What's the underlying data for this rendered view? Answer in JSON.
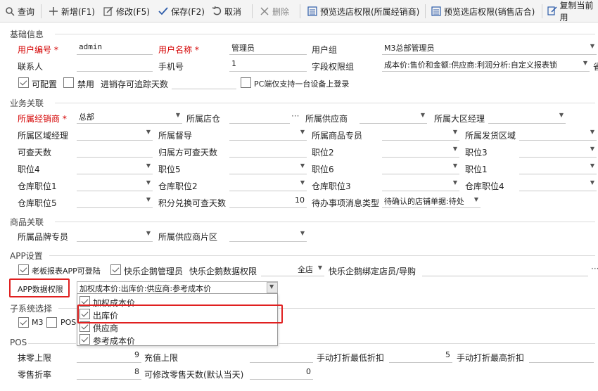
{
  "toolbar": {
    "query": "查询",
    "new": "新增(F1)",
    "edit": "修改(F5)",
    "save": "保存(F2)",
    "cancel": "取消",
    "delete": "删除",
    "preview_dealer": "预览选店权限(所属经销商)",
    "preview_sales": "预览选店权限(销售店合)",
    "copy": "复制当前用"
  },
  "sections": {
    "basic": "基础信息",
    "business": "业务关联",
    "goods": "商品关联",
    "app": "APP设置",
    "subsystem": "子系统选择",
    "pos": "POS"
  },
  "basic": {
    "user_no_label": "用户编号",
    "user_no": "admin",
    "user_name_label": "用户名称",
    "user_name": "管理员",
    "group_label": "用户组",
    "group": "M3总部管理员",
    "contact_label": "联系人",
    "contact": "",
    "phone_label": "手机号",
    "phone": "1",
    "field_perm_label": "字段权限组",
    "field_perm": "成本价:售价和金额:供应商:利润分析:自定义报表锁",
    "field_perm_more": "省",
    "configurable_label": "可配置",
    "disabled_label": "禁用",
    "stock_days_label": "进销存可追踪天数",
    "stock_days": "",
    "pc_single_label": "PC端仅支持一台设备上登录"
  },
  "business": {
    "dealer_label": "所属经销商",
    "dealer": "总部",
    "store_label": "所属店仓",
    "store": "",
    "supplier_label": "所属供应商",
    "region_mgr_label": "所属大区经理",
    "area_mgr_label": "所属区域经理",
    "supervisor_label": "所属督导",
    "goods_specialist_label": "所属商品专员",
    "ship_area_label": "所属发货区域",
    "query_days_label": "可查天数",
    "return_days_label": "归属方可查天数",
    "pos2_label": "职位2",
    "pos3_label": "职位3",
    "pos4_label": "职位4",
    "pos5_label": "职位5",
    "pos6_label": "职位6",
    "pos1_label": "职位1",
    "wh_pos1_label": "仓库职位1",
    "wh_pos2_label": "仓库职位2",
    "wh_pos3_label": "仓库职位3",
    "wh_pos4_label": "仓库职位4",
    "wh_pos5_label": "仓库职位5",
    "points_days_label": "积分兑换可查天数",
    "points_days": "10",
    "todo_type_label": "待办事项消息类型",
    "todo_type": "待确认的店铺单据:待处"
  },
  "goods": {
    "brand_specialist_label": "所属品牌专员",
    "supplier_area_label": "所属供应商片区"
  },
  "app": {
    "boss_report_label": "老板报表APP可登陆",
    "wecom_admin_label": "快乐企鹅管理员",
    "wecom_data_perm_label": "快乐企鹅数据权限",
    "wecom_data_perm": "全店",
    "wecom_bind_label": "快乐企鹅绑定店员/导购",
    "app_data_perm_label": "APP数据权限",
    "app_data_perm": "加权成本价:出库价:供应商:参考成本价",
    "options": [
      {
        "label": "加权成本价",
        "checked": true
      },
      {
        "label": "出库价",
        "checked": true
      },
      {
        "label": "供应商",
        "checked": true
      },
      {
        "label": "参考成本价",
        "checked": true
      }
    ]
  },
  "subsystem": {
    "m3_label": "M3",
    "pos_label": "POS"
  },
  "pos": {
    "wipe_limit_label": "抹零上限",
    "wipe_limit": "9",
    "recharge_limit_label": "充值上限",
    "recharge_limit": "",
    "manual_min_label": "手动打折最低折扣",
    "manual_min": "5",
    "manual_max_label": "手动打折最高折扣",
    "manual_max": "",
    "retail_discount_label": "零售折率",
    "retail_discount": "8",
    "editable_days_label": "可修改零售天数(默认当天)",
    "editable_days": "0"
  },
  "colors": {
    "required": "#d40000",
    "highlight": "#e02020",
    "icon_blue": "#2b5aa8"
  }
}
